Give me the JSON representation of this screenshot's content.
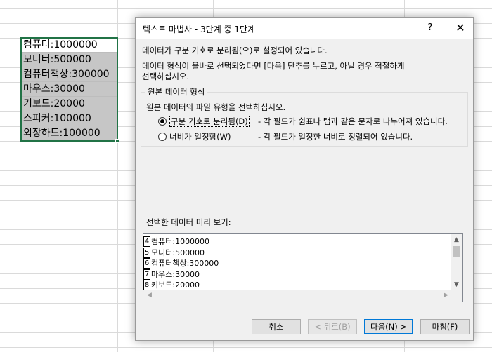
{
  "sheet": {
    "cells": [
      "컴퓨터:1000000",
      "모니터:500000",
      "컴퓨터책상:300000",
      "마우스:30000",
      "키보드:20000",
      "스피커:100000",
      "외장하드:100000"
    ]
  },
  "dialog": {
    "title": "텍스트 마법사 - 3단계 중 1단계",
    "help": "?",
    "close": "✕",
    "line1": "데이터가 구분 기호로 분리됨(으)로 설정되어 있습니다.",
    "line2": "데이터 형식이 올바로 선택되었다면 [다음] 단추를 누르고, 아닐 경우 적절하게",
    "line3": "선택하십시오.",
    "group_title": "원본 데이터 형식",
    "group_prompt": "원본 데이터의 파일 유형을 선택하십시오.",
    "options": [
      {
        "label": "구분 기호로 분리됨(D)",
        "desc": "- 각 필드가 쉼표나 탭과 같은 문자로 나누어져 있습니다.",
        "checked": true
      },
      {
        "label": "너비가 일정함(W)",
        "desc": "- 각 필드가 일정한 너비로 정렬되어 있습니다.",
        "checked": false
      }
    ],
    "preview_label": "선택한 데이터 미리 보기:",
    "preview_rows": [
      {
        "num": "4",
        "text": "컴퓨터:1000000"
      },
      {
        "num": "5",
        "text": "모니터:500000"
      },
      {
        "num": "6",
        "text": "컴퓨터책상:300000"
      },
      {
        "num": "7",
        "text": "마우스:30000"
      },
      {
        "num": "8",
        "text": "키보드:20000"
      }
    ],
    "buttons": {
      "cancel": "취소",
      "back": "< 뒤로(B)",
      "next": "다음(N) >",
      "finish": "마침(F)"
    }
  }
}
